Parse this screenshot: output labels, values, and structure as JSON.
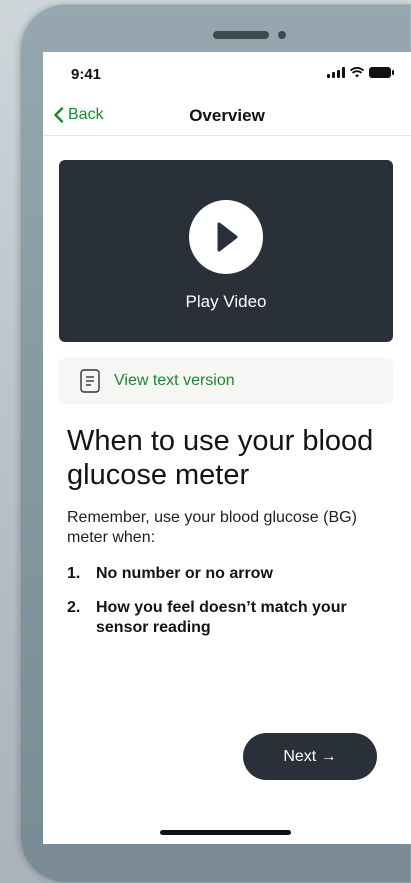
{
  "status_bar": {
    "time": "9:41"
  },
  "nav": {
    "back_label": "Back",
    "title": "Overview"
  },
  "video": {
    "label": "Play Video"
  },
  "text_version": {
    "label": "View text version"
  },
  "content": {
    "heading": "When to use your blood glucose meter",
    "intro": "Remember, use your blood glucose (BG) meter when:",
    "list": [
      {
        "num": "1.",
        "text": "No number or no arrow"
      },
      {
        "num": "2.",
        "text": "How you feel doesn’t match your sensor reading"
      }
    ]
  },
  "footer": {
    "next_label": "Next →"
  },
  "colors": {
    "accent": "#1a8a2e",
    "dark": "#2a303a"
  }
}
